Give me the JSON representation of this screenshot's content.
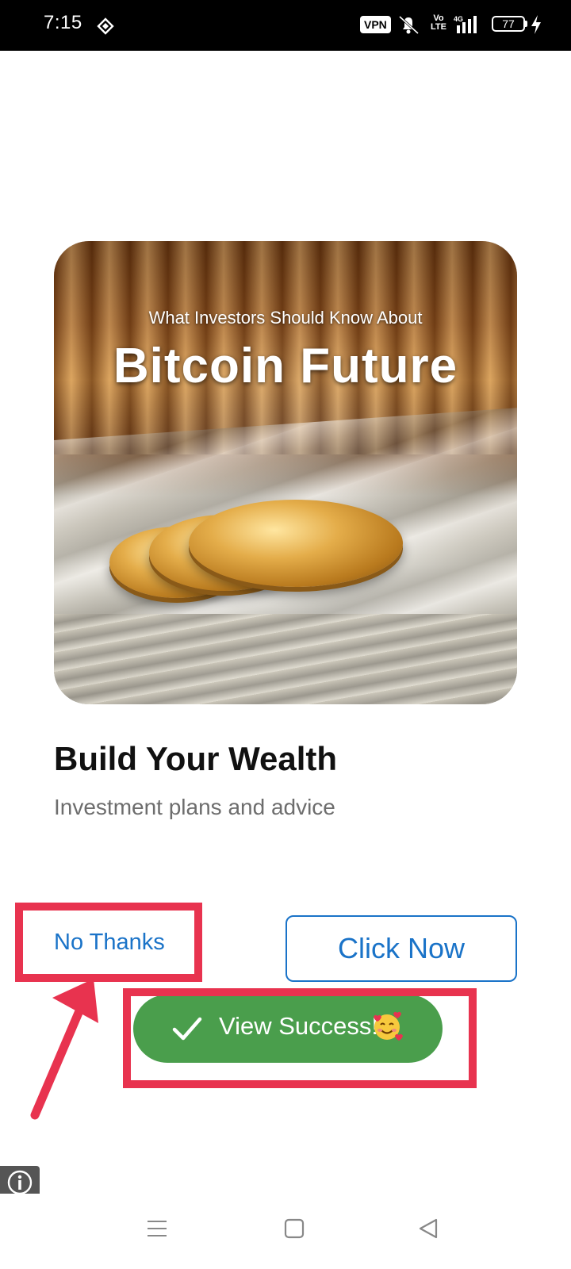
{
  "status_bar": {
    "time": "7:15",
    "vpn_label": "VPN",
    "volte_label": "Vo\nLTE",
    "network_label": "4G",
    "battery_level": "77"
  },
  "ad": {
    "image_subtitle": "What Investors Should Know About",
    "image_title": "Bitcoin Future",
    "headline": "Build Your Wealth",
    "description": "Investment plans and advice",
    "decline_label": "No Thanks",
    "cta_label": "Click Now"
  },
  "toast": {
    "message": "View Success!",
    "icon": "check-icon",
    "emoji": "smiling-face-with-hearts"
  },
  "colors": {
    "link_blue": "#1a73c8",
    "toast_green": "#4a9e4c",
    "annotation_red": "#e8334f"
  },
  "nav": {
    "icons": [
      "menu-icon",
      "home-square-icon",
      "back-triangle-icon"
    ]
  }
}
